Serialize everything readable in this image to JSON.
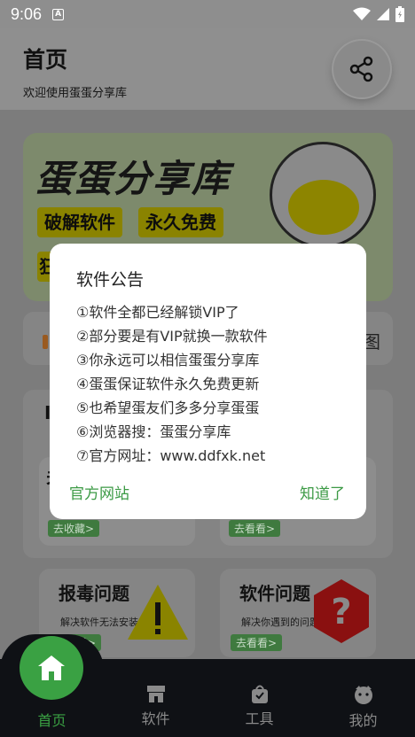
{
  "status_bar": {
    "time": "9:06",
    "notification_icon": "A"
  },
  "header": {
    "title": "首页",
    "subtitle": "欢迎使用蛋蛋分享库"
  },
  "banner": {
    "title": "蛋蛋分享库",
    "tags": [
      "破解软件",
      "永久免费",
      "狂"
    ]
  },
  "notice_bar": {
    "tail_text": "图"
  },
  "section": {
    "title_partial": "I",
    "cards": [
      {
        "title_partial": "关",
        "go_label": "去收藏>"
      },
      {
        "go_label": "去看看>"
      }
    ]
  },
  "tiles": [
    {
      "title": "报毒问题",
      "subtitle": "解决软件无法安装",
      "go_label": "去看看>"
    },
    {
      "title": "软件问题",
      "subtitle": "解决你遇到的问题",
      "go_label": "去看看>"
    }
  ],
  "bottom_nav": [
    {
      "label": "首页",
      "icon": "home-icon",
      "active": true
    },
    {
      "label": "软件",
      "icon": "store-icon",
      "active": false
    },
    {
      "label": "工具",
      "icon": "bag-icon",
      "active": false
    },
    {
      "label": "我的",
      "icon": "profile-icon",
      "active": false
    }
  ],
  "modal": {
    "title": "软件公告",
    "lines": [
      "①软件全都已经解锁VIP了",
      "②部分要是有VIP就换一款软件",
      "③你永远可以相信蛋蛋分享库",
      "④蛋蛋保证软件永久免费更新",
      "⑤也希望蛋友们多多分享蛋蛋",
      "⑥浏览器搜：蛋蛋分享库",
      "⑦官方网址：www.ddfxk.net"
    ],
    "left_button": "官方网站",
    "right_button": "知道了"
  },
  "colors": {
    "accent": "#3aa143",
    "nav_bg": "#0f1115",
    "scrim": "rgba(0,0,0,0.45)"
  }
}
